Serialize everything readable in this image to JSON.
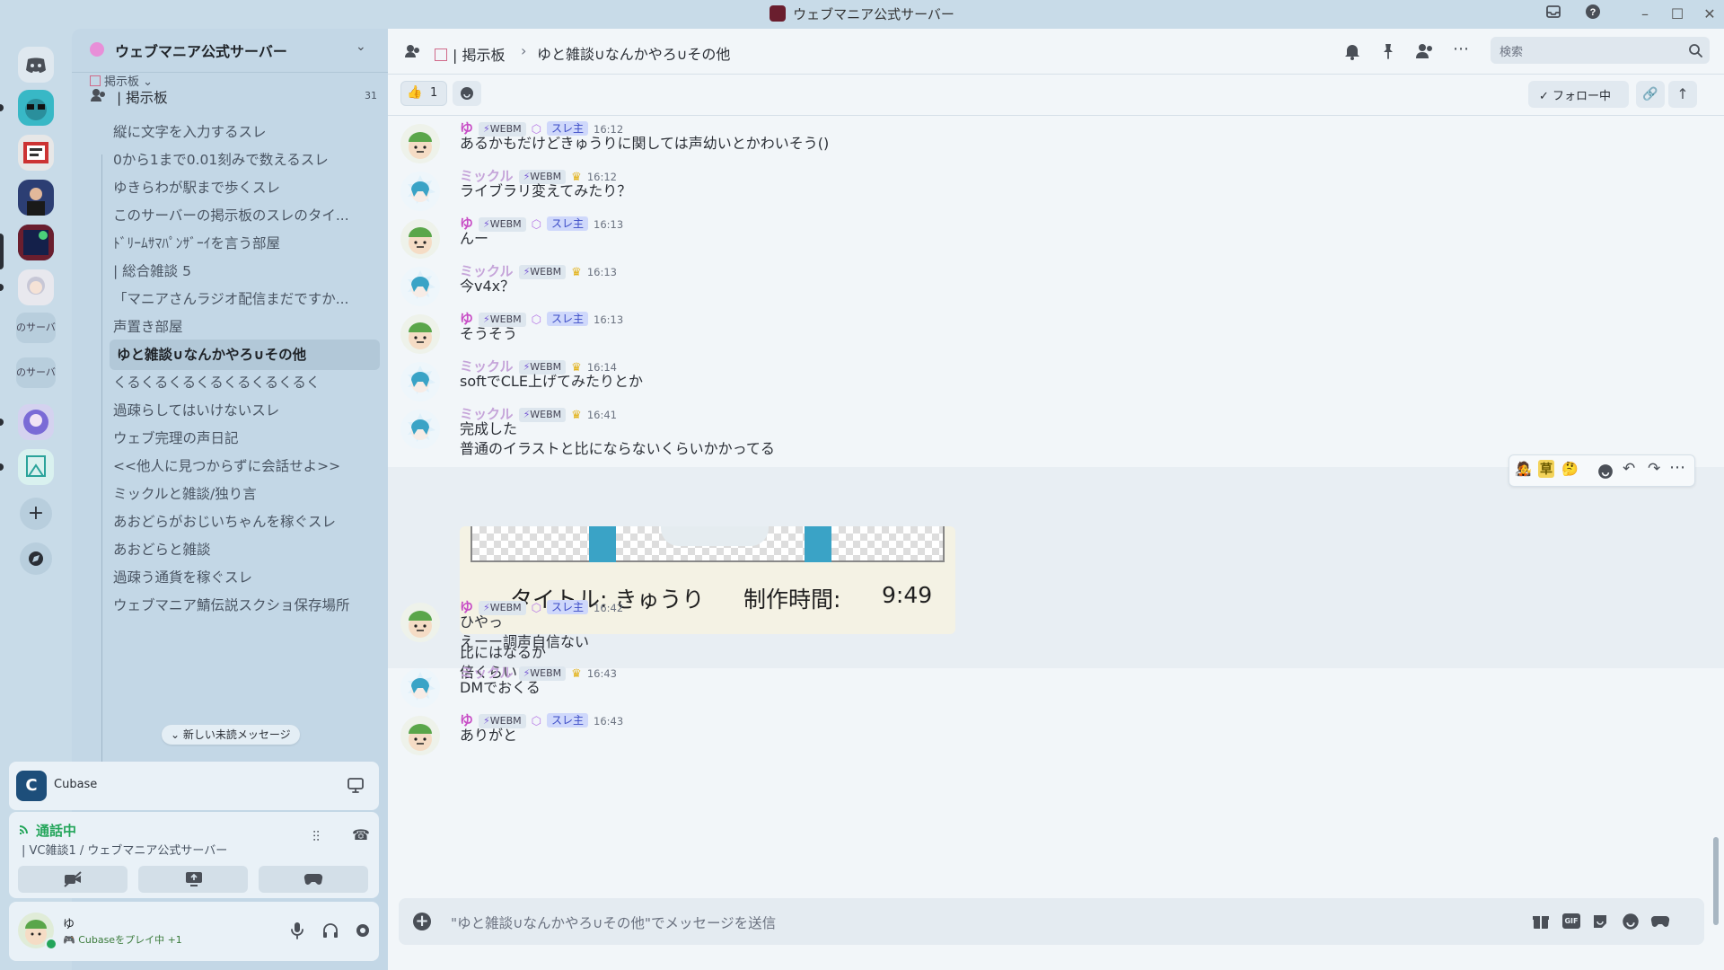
{
  "window": {
    "title": "ウェブマニア公式サーバー"
  },
  "server": {
    "name": "ウェブマニア公式サーバー"
  },
  "rail": {
    "server_texts": [
      "のサーバ",
      "のサーバ"
    ]
  },
  "channels": {
    "breadcrumb": "掲示板",
    "forum": {
      "name": "| 掲示板",
      "count": "31"
    },
    "threads": [
      "縦に文字を入力するスレ",
      "0から1まで0.01刻みで数えるスレ",
      "ゆきらわが駅まで歩くスレ",
      "このサーバーの掲示板のスレのタイ...",
      "ﾄﾞﾘｰﾑｻﾏﾊﾟﾝｻﾞｰｲを言う部屋",
      "| 総合雑談 5",
      "「マニアさんラジオ配信まだですか...",
      "声置き部屋",
      "ゆと雑談∪なんかやろ∪その他",
      "くるくるくるくるくるくるくるく",
      "過疎らしてはいけないスレ",
      "ウェブ完理の声日記",
      "<<他人に見つからずに会話せよ>>",
      "ミックルと雑談/独り言",
      "あおどらがおじいちゃんを稼ぐスレ",
      "あおどらと雑談",
      "過疎う通貨を稼ぐスレ",
      "ウェブマニア鯖伝説スクショ保存場所"
    ],
    "unread_pill": "新しい未読メッセージ"
  },
  "activity": {
    "app": "Cubase"
  },
  "voice": {
    "status": "通話中",
    "channel": "| VC雑談1 / ウェブマニア公式サーバー"
  },
  "user": {
    "name": "ゆ",
    "status": "Cubaseをプレイ中 +1"
  },
  "header": {
    "forum": "| 掲示板",
    "sep": "›",
    "thread": "ゆと雑談∪なんかやろ∪その他",
    "search_placeholder": "検索"
  },
  "subbar": {
    "reaction_count": "1",
    "follow_label": "フォロー中"
  },
  "messages": [
    {
      "user": "ゆ",
      "kind": "yu",
      "role": "WEBM",
      "badge": "スレ主",
      "time": "16:12",
      "lines": [
        "あるかもだけどきゅうりに関しては声幼いとかわいそう()"
      ]
    },
    {
      "user": "ミックル",
      "kind": "mk",
      "role": "WEBM",
      "time": "16:12",
      "lines": [
        "ライブラリ変えてみたり？"
      ]
    },
    {
      "user": "ゆ",
      "kind": "yu",
      "role": "WEBM",
      "badge": "スレ主",
      "time": "16:13",
      "lines": [
        "んー"
      ]
    },
    {
      "user": "ミックル",
      "kind": "mk",
      "role": "WEBM",
      "time": "16:13",
      "lines": [
        "今v4x？"
      ]
    },
    {
      "user": "ゆ",
      "kind": "yu",
      "role": "WEBM",
      "badge": "スレ主",
      "time": "16:13",
      "lines": [
        "そうそう"
      ]
    },
    {
      "user": "ミックル",
      "kind": "mk",
      "role": "WEBM",
      "time": "16:14",
      "lines": [
        "softでCLE上げてみたりとか"
      ]
    },
    {
      "user": "ミックル",
      "kind": "mk",
      "role": "WEBM",
      "time": "16:41",
      "lines": [
        "完成した",
        "普通のイラストと比にならないくらいかかってる"
      ]
    },
    {
      "user": "ゆ",
      "kind": "yu",
      "role": "WEBM",
      "badge": "スレ主",
      "time": "16:42",
      "lines": [
        "ひやっ",
        "えーー調声自信ない"
      ]
    },
    {
      "user": "ミックル",
      "kind": "mk",
      "role": "WEBM",
      "time": "16:43",
      "lines": [
        "DMでおくる"
      ]
    },
    {
      "user": "ゆ",
      "kind": "yu",
      "role": "WEBM",
      "badge": "スレ主",
      "time": "16:43",
      "lines": [
        "ありがと"
      ]
    }
  ],
  "attachment": {
    "title_label": "タイトル: きゅうり",
    "time_label": "制作時間:",
    "time_value": "9:49"
  },
  "followup": {
    "lines": [
      "比にはなるか",
      "倍くらい"
    ]
  },
  "composer": {
    "placeholder": "\"ゆと雑談∪なんかやろ∪その他\"でメッセージを送信"
  },
  "hover_toolbar": {
    "emoji1": "🧑‍🎤",
    "emoji2": "草",
    "emoji3": "🤔"
  },
  "colors": {
    "accent": "#5865f2",
    "yu": "#c84fc6",
    "mikkuru": "#c5a4d9",
    "crown": "#e3b21a"
  }
}
